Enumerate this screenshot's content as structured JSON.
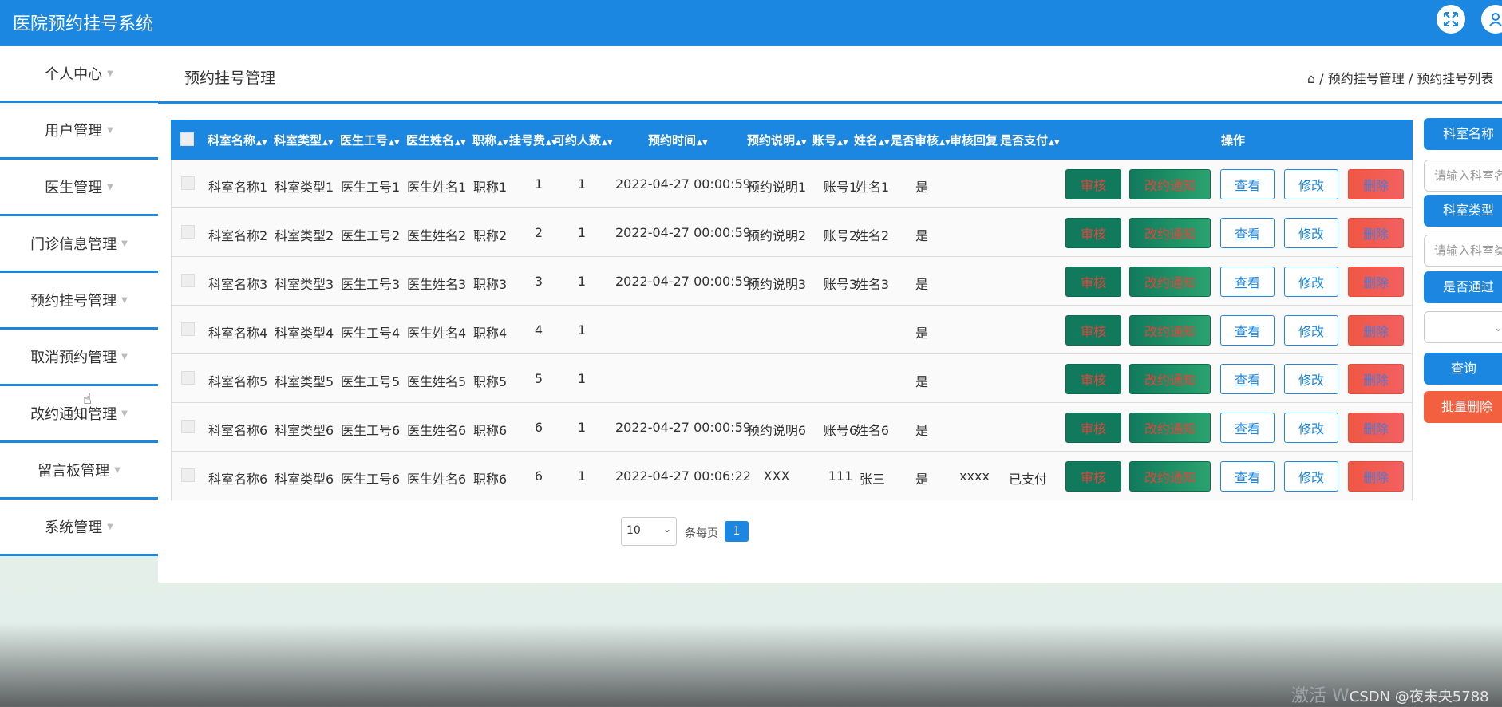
{
  "header": {
    "title": "医院预约挂号系统",
    "icons": [
      "fullscreen-icon",
      "user-icon"
    ]
  },
  "sidebar": {
    "items": [
      {
        "label": "个人中心"
      },
      {
        "label": "用户管理"
      },
      {
        "label": "医生管理"
      },
      {
        "label": "门诊信息管理"
      },
      {
        "label": "预约挂号管理"
      },
      {
        "label": "取消预约管理"
      },
      {
        "label": "改约通知管理"
      },
      {
        "label": "留言板管理"
      },
      {
        "label": "系统管理"
      }
    ]
  },
  "page": {
    "title": "预约挂号管理",
    "breadcrumb": "/ 预约挂号管理 / 预约挂号列表"
  },
  "table": {
    "headers": [
      "科室名称",
      "科室类型",
      "医生工号",
      "医生姓名",
      "职称",
      "挂号费",
      "可约人数",
      "预约时间",
      "预约说明",
      "账号",
      "姓名",
      "是否审核",
      "审核回复",
      "是否支付",
      "操作"
    ],
    "rows": [
      {
        "dept": "科室名称1",
        "type": "科室类型1",
        "docno": "医生工号1",
        "docname": "医生姓名1",
        "title": "职称1",
        "fee": "1",
        "quota": "1",
        "time": "2022-04-27 00:00:59",
        "note": "预约说明1",
        "account": "账号1",
        "name": "姓名1",
        "audit": "是",
        "reply": "",
        "paid": ""
      },
      {
        "dept": "科室名称2",
        "type": "科室类型2",
        "docno": "医生工号2",
        "docname": "医生姓名2",
        "title": "职称2",
        "fee": "2",
        "quota": "1",
        "time": "2022-04-27 00:00:59",
        "note": "预约说明2",
        "account": "账号2",
        "name": "姓名2",
        "audit": "是",
        "reply": "",
        "paid": ""
      },
      {
        "dept": "科室名称3",
        "type": "科室类型3",
        "docno": "医生工号3",
        "docname": "医生姓名3",
        "title": "职称3",
        "fee": "3",
        "quota": "1",
        "time": "2022-04-27 00:00:59",
        "note": "预约说明3",
        "account": "账号3",
        "name": "姓名3",
        "audit": "是",
        "reply": "",
        "paid": ""
      },
      {
        "dept": "科室名称4",
        "type": "科室类型4",
        "docno": "医生工号4",
        "docname": "医生姓名4",
        "title": "职称4",
        "fee": "4",
        "quota": "1",
        "time": "",
        "note": "",
        "account": "",
        "name": "",
        "audit": "是",
        "reply": "",
        "paid": ""
      },
      {
        "dept": "科室名称5",
        "type": "科室类型5",
        "docno": "医生工号5",
        "docname": "医生姓名5",
        "title": "职称5",
        "fee": "5",
        "quota": "1",
        "time": "",
        "note": "",
        "account": "",
        "name": "",
        "audit": "是",
        "reply": "",
        "paid": ""
      },
      {
        "dept": "科室名称6",
        "type": "科室类型6",
        "docno": "医生工号6",
        "docname": "医生姓名6",
        "title": "职称6",
        "fee": "6",
        "quota": "1",
        "time": "2022-04-27 00:00:59",
        "note": "预约说明6",
        "account": "账号6",
        "name": "姓名6",
        "audit": "是",
        "reply": "",
        "paid": ""
      },
      {
        "dept": "科室名称6",
        "type": "科室类型6",
        "docno": "医生工号6",
        "docname": "医生姓名6",
        "title": "职称6",
        "fee": "6",
        "quota": "1",
        "time": "2022-04-27 00:06:22",
        "note": "XXX",
        "account": "111",
        "name": "张三",
        "audit": "是",
        "reply": "xxxx",
        "paid": "已支付"
      }
    ],
    "actions": {
      "audit": "审核",
      "notice": "改约通知",
      "view": "查看",
      "edit": "修改",
      "delete": "删除"
    }
  },
  "pagination": {
    "page_size": "10",
    "per_page_label": "条每页",
    "current_page": "1"
  },
  "filters": {
    "dept_label": "科室名称",
    "dept_placeholder": "请输入科室名称",
    "type_label": "科室类型",
    "type_placeholder": "请输入科室类型",
    "approved_label": "是否通过",
    "approved_value": "",
    "query": "查询",
    "batch_delete": "批量删除"
  },
  "watermark": {
    "faded": "激活 W",
    "text": "CSDN @夜未央5788"
  },
  "colors": {
    "primary": "#1c87e0",
    "audit": "#117a5c",
    "delete": "#f05744"
  }
}
